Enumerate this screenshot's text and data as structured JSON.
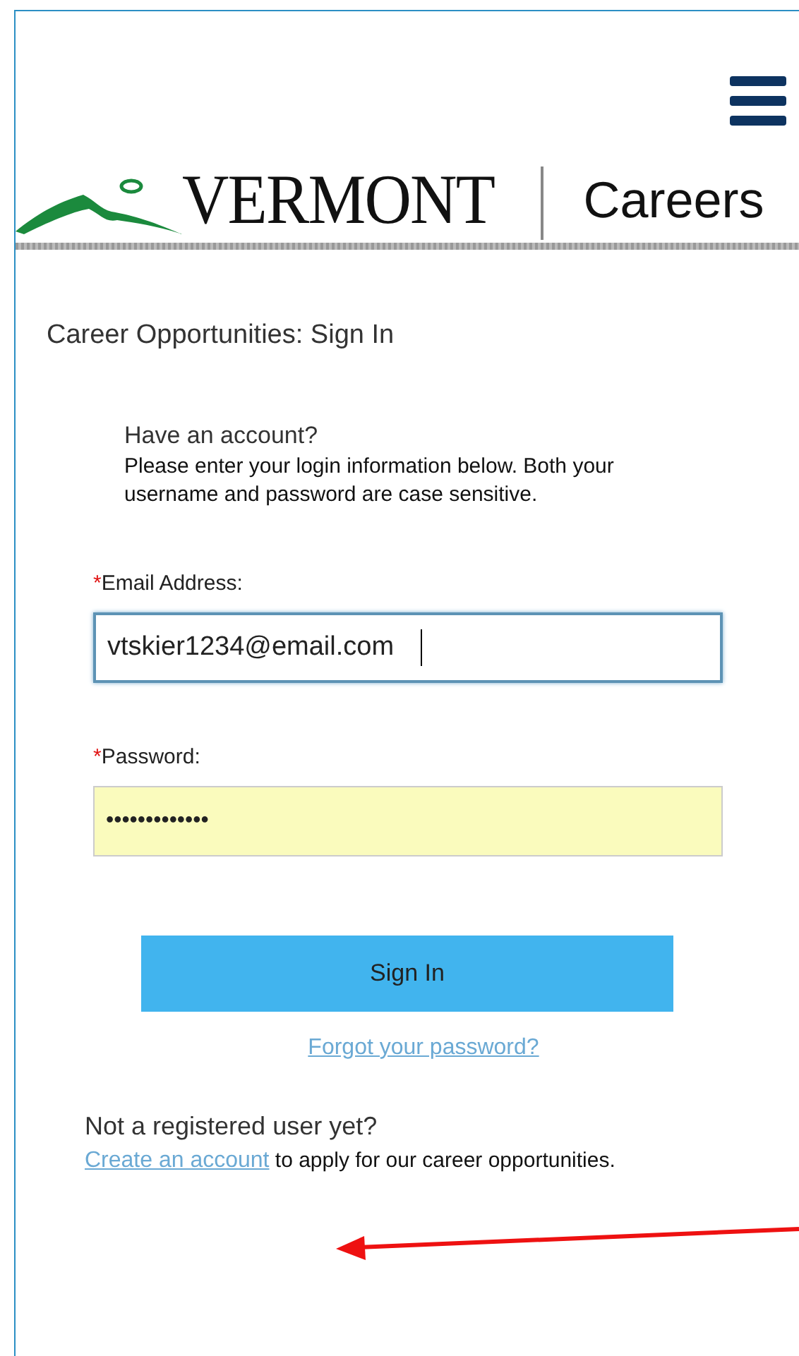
{
  "header": {
    "logo_text": "VERMONT",
    "section": "Careers"
  },
  "page_title": "Career Opportunities: Sign In",
  "intro": {
    "heading": "Have an account?",
    "text": "Please enter your login information below. Both your username and password are case sensitive."
  },
  "fields": [
    {
      "required_mark": "*",
      "label": "Email Address:",
      "value": "vtskier1234@email.com",
      "focused": true,
      "autofilled": false
    },
    {
      "required_mark": "*",
      "label": "Password:",
      "value": "•••••••••••••",
      "focused": false,
      "autofilled": true
    }
  ],
  "sign_in_button": "Sign In",
  "forgot_link": "Forgot your password?",
  "register": {
    "heading": "Not a registered user yet?",
    "link": "Create an account",
    "text": " to apply for our career opportunities."
  }
}
